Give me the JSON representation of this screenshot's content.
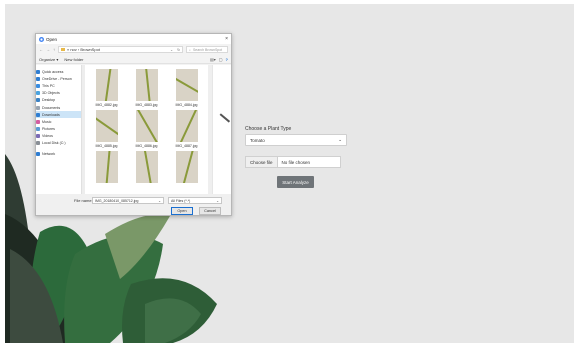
{
  "form": {
    "plant_label": "Choose a Plant Type",
    "plant_value": "Tomato",
    "choose_file_label": "Choose file",
    "file_status": "No file chosen",
    "analyze_label": "Start Analyze"
  },
  "dialog": {
    "title": "Open",
    "close_icon": "×",
    "back_icon": "←",
    "forward_icon": "→",
    "up_icon": "↑",
    "path": "« nov › BrownSpot",
    "search_placeholder": "Search BrownSpot",
    "organize_label": "Organize ▾",
    "new_folder_label": "New folder",
    "help_icon": "?",
    "nav_items": [
      {
        "label": "Quick access",
        "color": "#2f7dd1"
      },
      {
        "label": "OneDrive - Person",
        "color": "#2f7dd1"
      },
      {
        "label": "This PC",
        "color": "#3a8de0"
      },
      {
        "label": "3D Objects",
        "color": "#4aa3df"
      },
      {
        "label": "Desktop",
        "color": "#3b82c4"
      },
      {
        "label": "Documents",
        "color": "#9aa5b1"
      },
      {
        "label": "Downloads",
        "color": "#2f7dd1"
      },
      {
        "label": "Music",
        "color": "#d35ca0"
      },
      {
        "label": "Pictures",
        "color": "#5a9bd5"
      },
      {
        "label": "Videos",
        "color": "#7b6bb5"
      },
      {
        "label": "Local Disk (C:)",
        "color": "#8a8f96"
      },
      {
        "label": "Network",
        "color": "#2f7dd1"
      }
    ],
    "files": [
      {
        "name": "IMG_4882.jpg"
      },
      {
        "name": "IMG_4883.jpg"
      },
      {
        "name": "IMG_4884.jpg"
      },
      {
        "name": "IMG_4885.jpg"
      },
      {
        "name": "IMG_4886.jpg"
      },
      {
        "name": "IMG_4887.jpg"
      },
      {
        "name": ""
      },
      {
        "name": ""
      },
      {
        "name": ""
      }
    ],
    "filename_label": "File name:",
    "filename_value": "IMG_20180410_085712.jpg",
    "filter_value": "All Files (*.*)",
    "open_label": "Open",
    "cancel_label": "Cancel"
  },
  "colors": {
    "page_background": "#e7e7e7",
    "analyze_button": "#6f7478",
    "dialog_accent": "#1a6fd0"
  }
}
